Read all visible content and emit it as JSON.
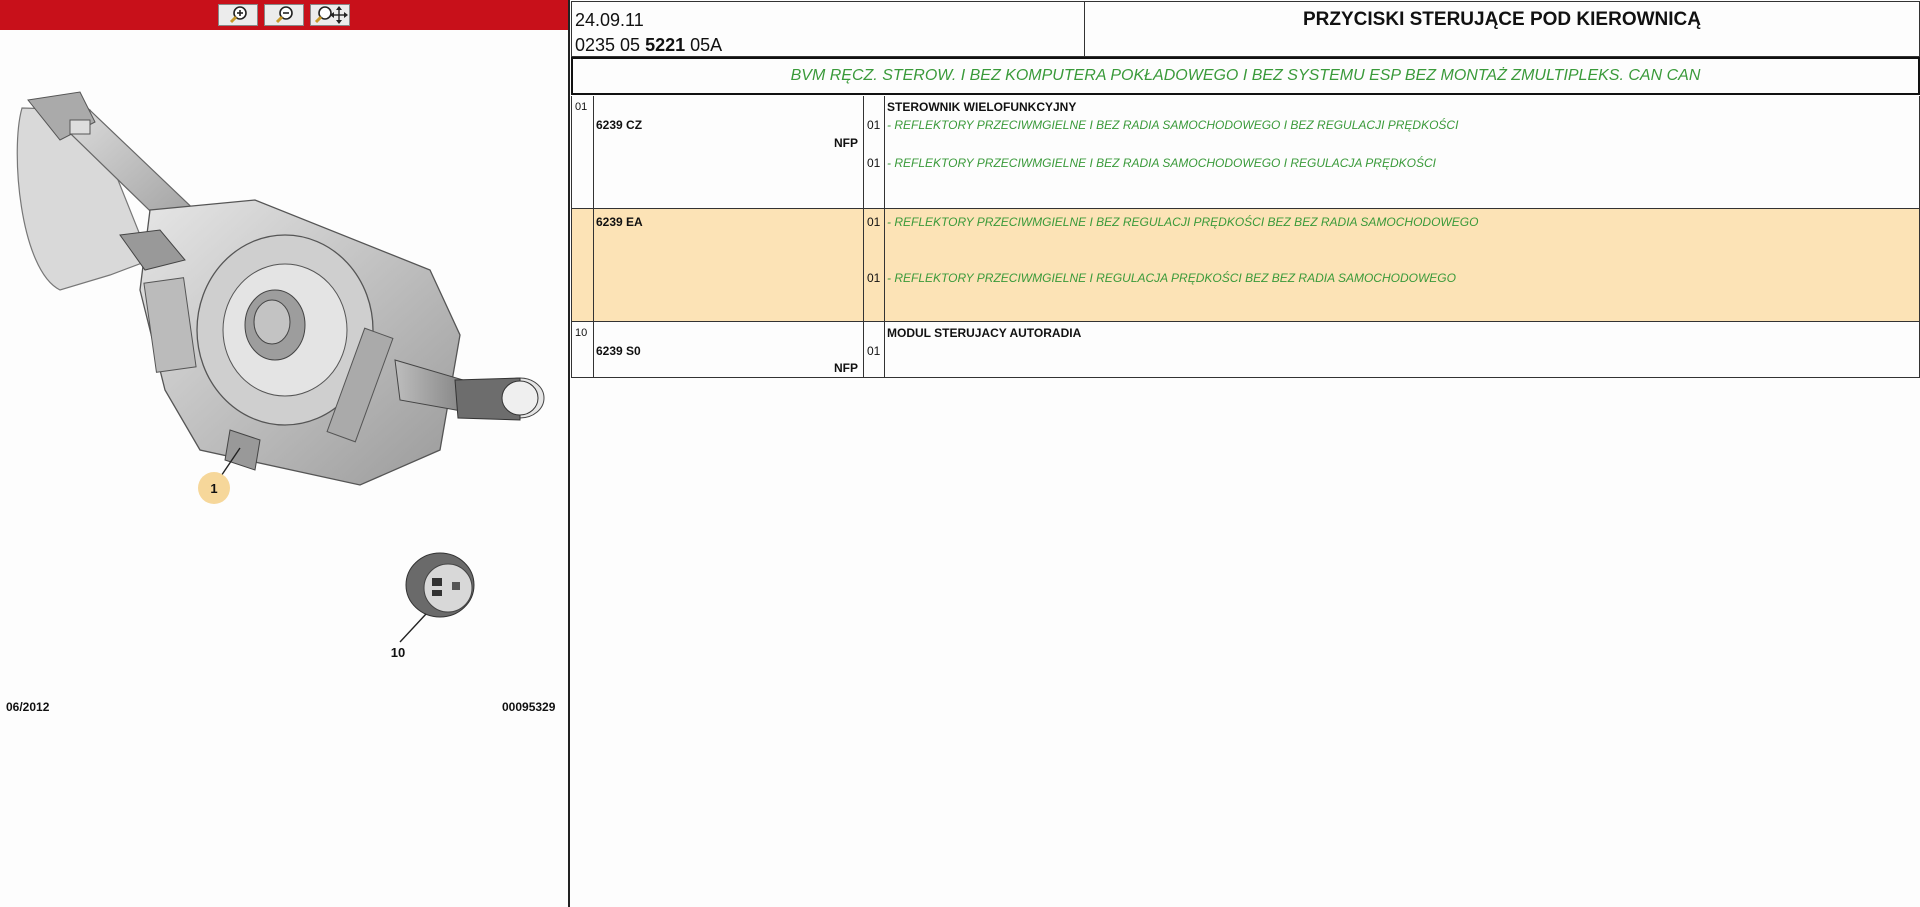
{
  "toolbar": {
    "zoom_in_icon": "zoom-in-icon",
    "zoom_out_icon": "zoom-out-icon",
    "pan_zoom_icon": "pan-zoom-icon"
  },
  "diagram": {
    "callouts": [
      "1",
      "10"
    ],
    "date_code": "06/2012",
    "image_code": "00095329"
  },
  "header": {
    "date": "24.09.11",
    "ref_prefix": "0235 05 ",
    "ref_bold": "5221",
    "ref_suffix": " 05A",
    "title": "PRZYCISKI STERUJĄCE POD KIEROWNICĄ"
  },
  "variant": "BVM RĘCZ. STEROW. I BEZ KOMPUTERA POKŁADOWEGO I BEZ SYSTEMU ESP BEZ MONTAŻ ZMULTIPLEKS. CAN CAN",
  "rows": [
    {
      "index": "01",
      "part": "6239 CZ",
      "nfp": "NFP",
      "name": "STEROWNIK WIELOFUNKCYJNY",
      "q1": "01",
      "d1": "- REFLEKTORY PRZECIWMGIELNE I BEZ RADIA SAMOCHODOWEGO I BEZ REGULACJI PRĘDKOŚCI",
      "q2": "01",
      "d2": "- REFLEKTORY PRZECIWMGIELNE I BEZ RADIA SAMOCHODOWEGO I REGULACJA PRĘDKOŚCI"
    },
    {
      "part": "6239 EA",
      "q1": "01",
      "d1": "- REFLEKTORY PRZECIWMGIELNE I BEZ REGULACJI PRĘDKOŚCI BEZ BEZ RADIA SAMOCHODOWEGO",
      "q2": "01",
      "d2": "- REFLEKTORY PRZECIWMGIELNE I REGULACJA PRĘDKOŚCI BEZ BEZ RADIA SAMOCHODOWEGO"
    },
    {
      "index": "10",
      "part": "6239 S0",
      "nfp": "NFP",
      "name": "MODUL STERUJACY AUTORADIA",
      "q1": "01"
    }
  ],
  "colors": {
    "toolbar": "#c8101a",
    "highlight": "#fce3b6",
    "green_text": "#3a9a3a",
    "callout": "#f6d79a"
  }
}
